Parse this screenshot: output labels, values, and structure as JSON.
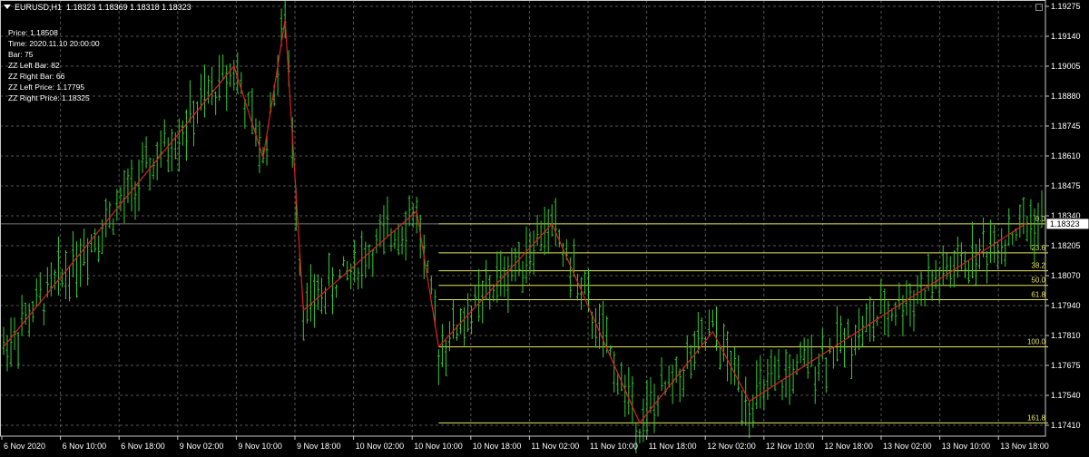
{
  "header": {
    "symbol": "EURUSD,H1",
    "ohlc": "1.18323 1.18369 1.18318 1.18323"
  },
  "info_panel": [
    {
      "label": "Price",
      "value": "1.18508"
    },
    {
      "label": "Time",
      "value": "2020.11.10 20:00:00"
    },
    {
      "label": "Bar",
      "value": "75"
    },
    {
      "label": "ZZ Left Bar",
      "value": "82"
    },
    {
      "label": "ZZ Right Bar",
      "value": "66"
    },
    {
      "label": "ZZ Left Price",
      "value": "1.17795"
    },
    {
      "label": "ZZ Right Price",
      "value": "1.18325"
    }
  ],
  "chart_data": {
    "type": "bar",
    "bar_color": "#32cd32",
    "zigzag_color": "#e02020",
    "fib_color": "#e6e65a",
    "background": "#000000",
    "grid": true,
    "current_price_label": "1.18323",
    "y_ticks": [
      "1.19275",
      "1.19140",
      "1.19005",
      "1.18880",
      "1.18745",
      "1.18610",
      "1.18475",
      "1.18340",
      "1.18205",
      "1.18070",
      "1.17940",
      "1.17810",
      "1.17675",
      "1.17540",
      "1.17410"
    ],
    "x_ticks": [
      "6 Nov 2020",
      "6 Nov 10:00",
      "6 Nov 18:00",
      "9 Nov 02:00",
      "9 Nov 10:00",
      "9 Nov 18:00",
      "10 Nov 02:00",
      "10 Nov 10:00",
      "10 Nov 18:00",
      "11 Nov 02:00",
      "11 Nov 10:00",
      "11 Nov 18:00",
      "12 Nov 02:00",
      "12 Nov 10:00",
      "12 Nov 18:00",
      "13 Nov 02:00",
      "13 Nov 10:00",
      "13 Nov 18:00"
    ],
    "fib_levels": [
      {
        "label": "0.0",
        "price": 1.18325
      },
      {
        "label": "23.6",
        "price": 1.182
      },
      {
        "label": "38.2",
        "price": 1.18123
      },
      {
        "label": "50.0",
        "price": 1.1806
      },
      {
        "label": "61.8",
        "price": 1.17998
      },
      {
        "label": "100.0",
        "price": 1.17795
      },
      {
        "label": "161.8",
        "price": 1.17467
      }
    ],
    "zigzag": [
      [
        0,
        1.17795
      ],
      [
        63,
        1.19005
      ],
      [
        71,
        1.1861
      ],
      [
        77,
        1.19205
      ],
      [
        82,
        1.17952
      ],
      [
        113,
        1.1838
      ],
      [
        119,
        1.17795
      ],
      [
        150,
        1.18325
      ],
      [
        174,
        1.17467
      ],
      [
        194,
        1.1786
      ],
      [
        204,
        1.1756
      ],
      [
        280,
        1.1833
      ]
    ],
    "price_min": 1.1741,
    "price_max": 1.1929,
    "bar_count": 285
  }
}
